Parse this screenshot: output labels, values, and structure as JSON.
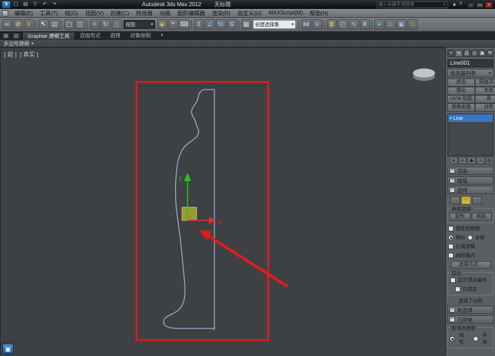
{
  "ui": {
    "caret": "▾",
    "plus": "+",
    "minus": "−",
    "bulb": "●"
  },
  "window": {
    "app_title": "Autodesk 3ds Max 2012",
    "doc_title": "无标题",
    "search_placeholder": "键入关键字或短语"
  },
  "titlebar": {
    "quick_icons": [
      {
        "name": "app-logo-icon",
        "glyph": "3"
      },
      {
        "name": "new-scene-icon",
        "glyph": "▢"
      },
      {
        "name": "open-file-icon",
        "glyph": "▤"
      },
      {
        "name": "save-file-icon",
        "glyph": "▽"
      },
      {
        "name": "undo-icon",
        "glyph": "↶"
      },
      {
        "name": "redo-icon",
        "glyph": "↷"
      }
    ],
    "right_icons": [
      {
        "name": "star-icon",
        "glyph": "★"
      },
      {
        "name": "help-icon",
        "glyph": "?"
      }
    ],
    "window_controls": [
      {
        "name": "minimize-button",
        "glyph": "–"
      },
      {
        "name": "maximize-button",
        "glyph": "▭"
      },
      {
        "name": "close-button",
        "glyph": "×"
      }
    ]
  },
  "menus": [
    "编辑(E)",
    "工具(T)",
    "组(G)",
    "视图(V)",
    "创建(C)",
    "修改器",
    "动画",
    "图形编辑器",
    "渲染(R)",
    "自定义(U)",
    "MAXScript(M)",
    "帮助(H)"
  ],
  "toolbar": {
    "items": [
      {
        "type": "icon",
        "name": "select-and-link-icon",
        "glyph": "∞",
        "color": "#d8c86a"
      },
      {
        "type": "icon",
        "name": "unlink-selection-icon",
        "glyph": "⊘",
        "color": "#d8c86a"
      },
      {
        "type": "icon",
        "name": "bind-to-space-warp-icon",
        "glyph": "≀",
        "color": "#d8c86a"
      },
      {
        "type": "sep"
      },
      {
        "type": "icon",
        "name": "select-object-icon",
        "glyph": "↖",
        "color": "#eceef0"
      },
      {
        "type": "icon",
        "name": "select-by-name-icon",
        "glyph": "▤",
        "color": "#9fc8e8"
      },
      {
        "type": "sep"
      },
      {
        "type": "icon",
        "name": "rectangular-selection-icon",
        "glyph": "▢",
        "color": "#d0d3d6"
      },
      {
        "type": "icon",
        "name": "window-crossing-icon",
        "glyph": "◫",
        "color": "#d0d3d6"
      },
      {
        "type": "sep"
      },
      {
        "type": "icon",
        "name": "select-and-move-icon",
        "glyph": "+",
        "color": "#8fd08f"
      },
      {
        "type": "icon",
        "name": "select-and-rotate-icon",
        "glyph": "↻",
        "color": "#8fd08f"
      },
      {
        "type": "icon",
        "name": "select-and-scale-icon",
        "glyph": "△",
        "color": "#8fd08f"
      },
      {
        "type": "combo",
        "name": "reference-coordinate-combo",
        "value": "视图",
        "theme": "dark"
      },
      {
        "type": "icon",
        "name": "use-pivot-center-icon",
        "glyph": "◉",
        "color": "#d0b060"
      },
      {
        "type": "icon",
        "name": "select-and-manipulate-icon",
        "glyph": "*",
        "color": "#d0d3d6"
      },
      {
        "type": "icon",
        "name": "keyboard-override-icon",
        "glyph": "⌨",
        "color": "#d0d3d6"
      },
      {
        "type": "sep"
      },
      {
        "type": "icon",
        "name": "snaps-toggle-icon",
        "glyph": "3",
        "color": "#7fb8e8"
      },
      {
        "type": "icon",
        "name": "angle-snap-icon",
        "glyph": "∠",
        "color": "#7fb8e8"
      },
      {
        "type": "icon",
        "name": "percent-snap-icon",
        "glyph": "%",
        "color": "#7fb8e8"
      },
      {
        "type": "icon",
        "name": "spinner-snap-icon",
        "glyph": "⇅",
        "color": "#7fb8e8"
      },
      {
        "type": "sep"
      },
      {
        "type": "icon",
        "name": "edit-named-selections-icon",
        "glyph": "▦",
        "color": "#d0d3d6"
      },
      {
        "type": "combo",
        "name": "named-selection-sets-combo",
        "value": "创建选择集",
        "theme": "light"
      },
      {
        "type": "sep"
      },
      {
        "type": "icon",
        "name": "mirror-icon",
        "glyph": "⋈",
        "color": "#9fc8e8"
      },
      {
        "type": "icon",
        "name": "align-icon",
        "glyph": "≡",
        "color": "#9fc8e8"
      },
      {
        "type": "sep"
      },
      {
        "type": "icon",
        "name": "layer-manager-icon",
        "glyph": "≣",
        "color": "#d8c86a"
      },
      {
        "type": "icon",
        "name": "graphite-toggle-icon",
        "glyph": "◰",
        "color": "#9fc8e8"
      },
      {
        "type": "icon",
        "name": "curve-editor-icon",
        "glyph": "∿",
        "color": "#8fd08f"
      },
      {
        "type": "icon",
        "name": "schematic-view-icon",
        "glyph": "#",
        "color": "#d0d3d6"
      },
      {
        "type": "sep"
      },
      {
        "type": "icon",
        "name": "material-editor-icon",
        "glyph": "●",
        "color": "#4fc8d8"
      },
      {
        "type": "icon",
        "name": "render-setup-icon",
        "glyph": "♨",
        "color": "#c8cacc"
      },
      {
        "type": "icon",
        "name": "rendered-frame-icon",
        "glyph": "▣",
        "color": "#9fb8d8"
      },
      {
        "type": "icon",
        "name": "render-production-icon",
        "glyph": "♨",
        "color": "#e8a050"
      }
    ]
  },
  "ribbon": {
    "left_icons": [
      {
        "name": "ribbon-show-icon",
        "glyph": "▦"
      },
      {
        "name": "ribbon-config-icon",
        "glyph": "▧"
      }
    ],
    "tabs": [
      {
        "label": "Graphite 建模工具",
        "active": true
      },
      {
        "label": "自由形式",
        "active": false
      },
      {
        "label": "选择",
        "active": false
      },
      {
        "label": "对象绘制",
        "active": false
      }
    ],
    "collapse_glyph": "▼",
    "strip_label": "多边形建模"
  },
  "viewport": {
    "view_label": "[ 前 ]",
    "shading_label": "[ 真实 ]",
    "axis_x": "x",
    "axis_y": "y"
  },
  "panel": {
    "tabs": [
      {
        "name": "create-tab",
        "glyph": "+",
        "active": false
      },
      {
        "name": "modify-tab",
        "glyph": "∿",
        "active": true
      },
      {
        "name": "hierarchy-tab",
        "glyph": "品",
        "active": false
      },
      {
        "name": "motion-tab",
        "glyph": "◎",
        "active": false
      },
      {
        "name": "display-tab",
        "glyph": "▣",
        "active": false
      },
      {
        "name": "utilities-tab",
        "glyph": "⚒",
        "active": false
      }
    ],
    "object_name": "Line001",
    "modifier_list_label": "修改器列表",
    "modifier_buttons_left": [
      "挤出",
      "锥化",
      "UVW 贴图",
      "倒角剖面"
    ],
    "modifier_buttons_right": [
      "网格平滑",
      "车削",
      "壳",
      "对称"
    ],
    "stack_item": "Line",
    "stack_tools": [
      {
        "name": "pin-stack-icon",
        "glyph": "∗"
      },
      {
        "name": "show-end-result-icon",
        "glyph": "≡"
      },
      {
        "name": "make-unique-icon",
        "glyph": "◆"
      },
      {
        "name": "remove-modifier-icon",
        "glyph": "×"
      },
      {
        "name": "configure-sets-icon",
        "glyph": "▤"
      }
    ],
    "rollouts": {
      "render": "渲染",
      "interpolation": "插值",
      "selection": "选择",
      "soft_selection": "软选择",
      "geometry": "几何体"
    },
    "selection": {
      "subobject_icons": [
        {
          "name": "vertex-subobject-icon",
          "glyph": "∴",
          "active": false
        },
        {
          "name": "segment-subobject-icon",
          "glyph": "◠",
          "active": true
        },
        {
          "name": "spline-subobject-icon",
          "glyph": "∽",
          "active": false
        }
      ],
      "named_selection_label": "命名选择:",
      "copy_label": "复制",
      "paste_label": "粘贴",
      "lock_handles_label": "锁定控制柄",
      "alike_label": "相似",
      "all_label": "全部",
      "area_selection_label": "区域选择",
      "segment_end_label": "线段端点",
      "select_by_label": "选择方式...",
      "display_group_label": "显示",
      "show_vertex_numbers_label": "显示顶点编号",
      "selected_only_label": "仅选定",
      "status_text": "选择了分段"
    },
    "geometry": {
      "group_label": "新顶点类型",
      "radio1": "线性",
      "radio2": "平滑"
    }
  },
  "misc": {
    "bottom_left_icon_glyph": "▣"
  }
}
